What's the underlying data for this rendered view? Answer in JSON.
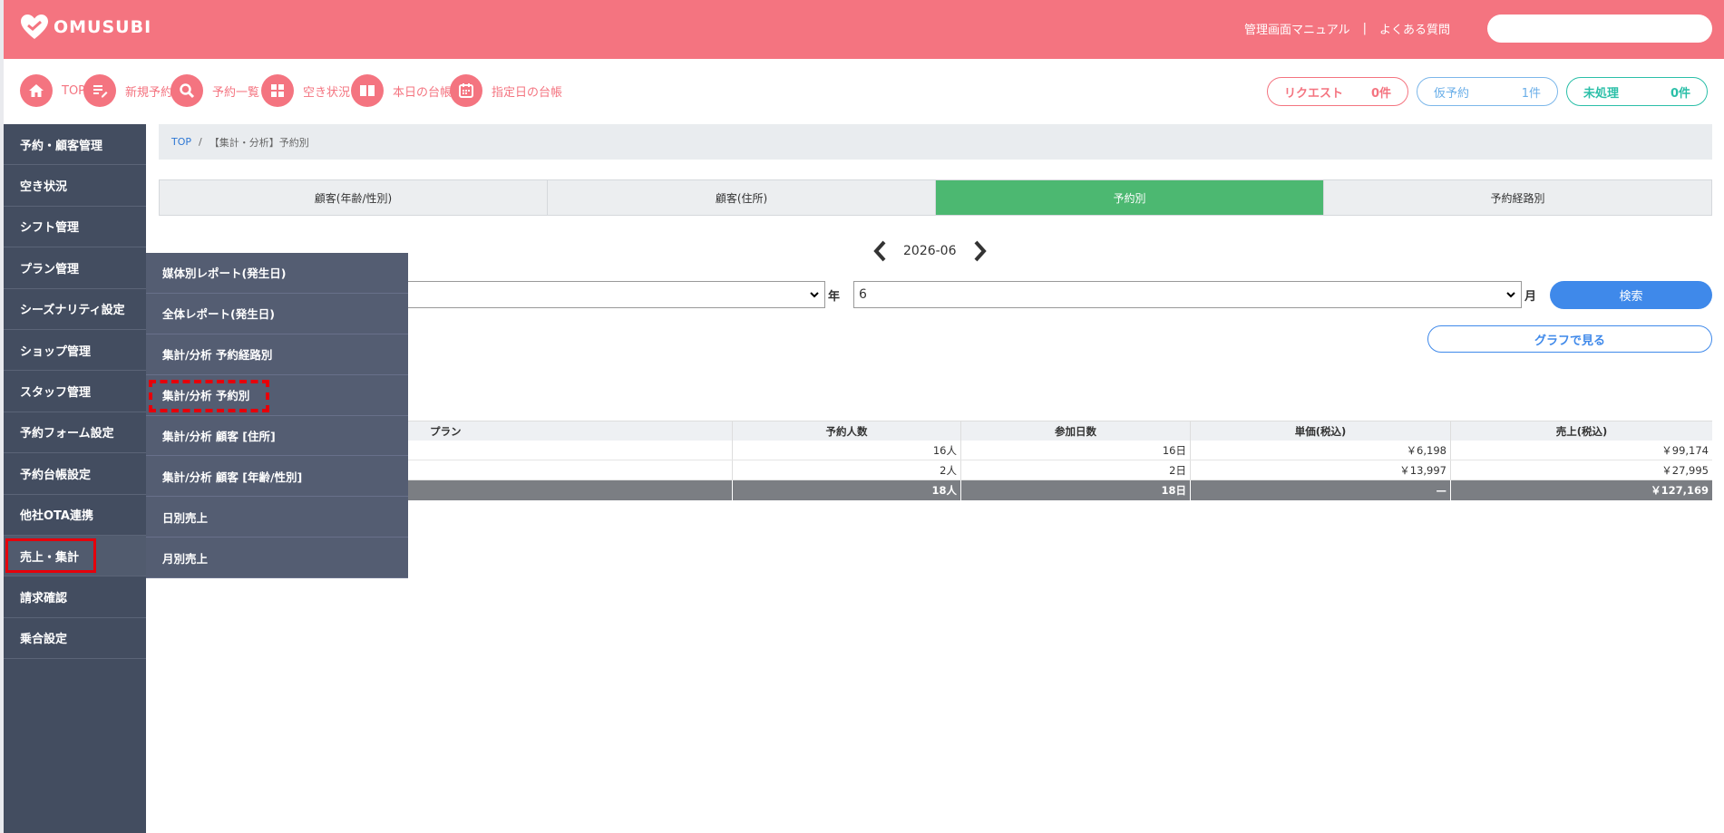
{
  "header": {
    "brand": "OMUSUBI",
    "links": [
      "管理画面マニュアル",
      "よくある質問"
    ],
    "separator": "|",
    "colors": {
      "primary": "#f47480"
    }
  },
  "nav": {
    "items": [
      {
        "label": "TOP",
        "icon": "home-icon"
      },
      {
        "label": "新規予約",
        "icon": "edit-list-icon"
      },
      {
        "label": "予約一覧",
        "icon": "search-icon"
      },
      {
        "label": "空き状況",
        "icon": "grid-icon"
      },
      {
        "label": "本日の台帳",
        "icon": "book-icon"
      },
      {
        "label": "指定日の台帳",
        "icon": "calendar-icon"
      }
    ],
    "status": {
      "request": {
        "label": "リクエスト",
        "count": "0件"
      },
      "tentative": {
        "label": "仮予約",
        "count": "1件"
      },
      "unprocessed": {
        "label": "未処理",
        "count": "0件"
      }
    }
  },
  "sidebar": {
    "items": [
      {
        "label": "予約・顧客管理"
      },
      {
        "label": "空き状況"
      },
      {
        "label": "シフト管理"
      },
      {
        "label": "プラン管理"
      },
      {
        "label": "シーズナリティ設定"
      },
      {
        "label": "ショップ管理"
      },
      {
        "label": "スタッフ管理"
      },
      {
        "label": "予約フォーム設定"
      },
      {
        "label": "予約台帳設定"
      },
      {
        "label": "他社OTA連携"
      },
      {
        "label": "売上・集計"
      },
      {
        "label": "請求確認"
      },
      {
        "label": "乗合設定"
      }
    ]
  },
  "submenu": {
    "items": [
      {
        "label": "媒体別レポート(発生日)"
      },
      {
        "label": "全体レポート(発生日)"
      },
      {
        "label": "集計/分析 予約経路別"
      },
      {
        "label": "集計/分析 予約別"
      },
      {
        "label": "集計/分析 顧客 [住所]"
      },
      {
        "label": "集計/分析 顧客 [年齢/性別]"
      },
      {
        "label": "日別売上"
      },
      {
        "label": "月別売上"
      }
    ]
  },
  "breadcrumb": {
    "top": "TOP",
    "sep": "/",
    "current": "【集計・分析】予約別"
  },
  "tabs": [
    {
      "label": "顧客(年齢/性別)"
    },
    {
      "label": "顧客(住所)"
    },
    {
      "label": "予約別",
      "active": true
    },
    {
      "label": "予約経路別"
    }
  ],
  "period": {
    "current": "2026-06"
  },
  "filters": {
    "year_value": "",
    "year_label": "年",
    "month_value": "6",
    "month_label": "月",
    "search_label": "検索",
    "graph_label": "グラフで見る"
  },
  "table": {
    "headers": {
      "plan": "プラン",
      "count": "予約人数",
      "days": "参加日数",
      "unit": "単価(税込)",
      "sales": "売上(税込)"
    },
    "rows": [
      {
        "plan": "",
        "count": "16人",
        "days": "16日",
        "unit": "￥6,198",
        "sales": "￥99,174"
      },
      {
        "plan": "",
        "count": "2人",
        "days": "2日",
        "unit": "￥13,997",
        "sales": "￥27,995"
      }
    ],
    "total": {
      "plan": "",
      "count": "18人",
      "days": "18日",
      "unit": "—",
      "sales": "￥127,169"
    }
  }
}
